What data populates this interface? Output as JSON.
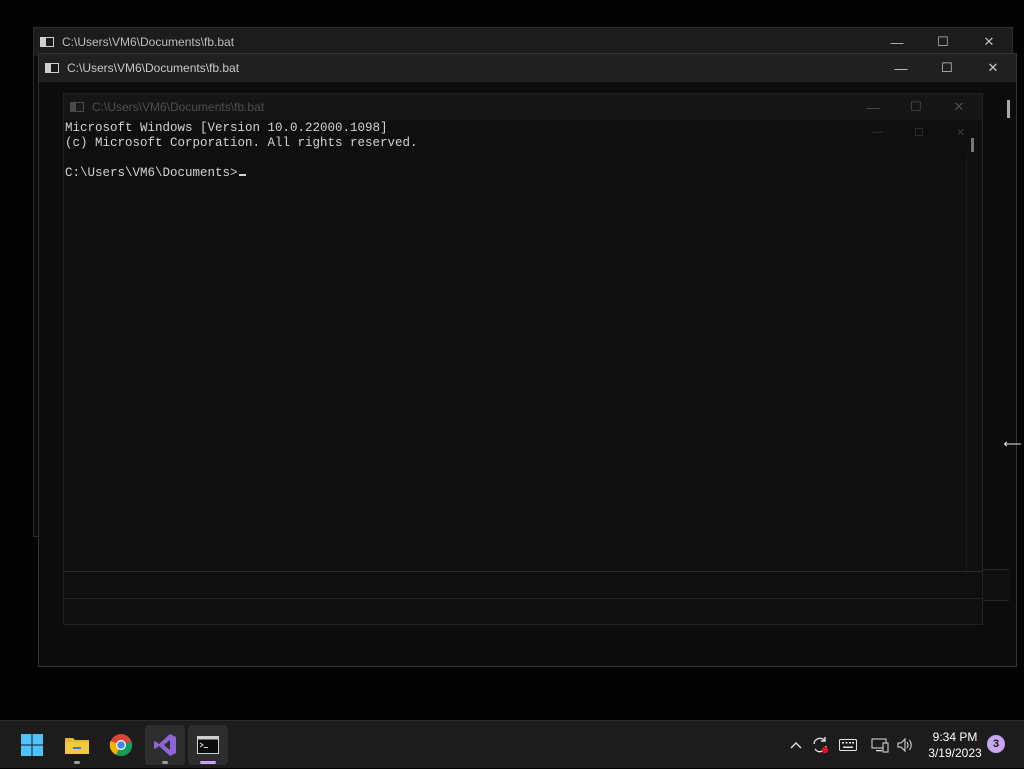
{
  "windows": [
    {
      "title": "C:\\Users\\VM6\\Documents\\fb.bat"
    },
    {
      "title": "C:\\Users\\VM6\\Documents\\fb.bat"
    },
    {
      "title": "C:\\Users\\VM6\\Documents\\fb.bat"
    }
  ],
  "window_controls": {
    "minimize": "—",
    "maximize": "☐",
    "close": "✕"
  },
  "console": {
    "lines": [
      "Microsoft Windows [Version 10.0.22000.1098]",
      "(c) Microsoft Corporation. All rights reserved.",
      "",
      "C:\\Users\\VM6\\Documents>"
    ]
  },
  "taskbar": {
    "apps": [
      {
        "name": "start-button",
        "icon": "windows-logo-icon"
      },
      {
        "name": "file-explorer",
        "icon": "folder-icon"
      },
      {
        "name": "chrome",
        "icon": "chrome-icon"
      },
      {
        "name": "visual-studio",
        "icon": "visual-studio-icon"
      },
      {
        "name": "terminal",
        "icon": "terminal-icon"
      }
    ],
    "tray": {
      "time": "9:34 PM",
      "date": "3/19/2023",
      "notification_count": "3"
    }
  },
  "colors": {
    "accent": "#c8a6f0",
    "taskbar": "#1c1c1c",
    "console_bg": "#0c0c0c"
  }
}
